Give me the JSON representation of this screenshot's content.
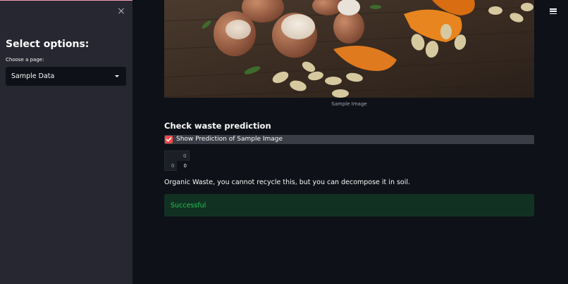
{
  "sidebar": {
    "close_icon": "×",
    "heading": "Select options:",
    "page_label": "Choose a page:",
    "page_select_value": "Sample Data"
  },
  "main": {
    "image_caption": "Sample Image",
    "section_title": "Check waste prediction",
    "checkbox_label": "Show Prediction of Sample Image",
    "checkbox_checked": true,
    "dataframe": {
      "column_header": "0",
      "row_index": "0",
      "cell_value": "0"
    },
    "prediction_text": "Organic Waste, you cannot recycle this, but you can decompose it in soil.",
    "success_message": "Successful"
  },
  "colors": {
    "sidebar_bg": "#262730",
    "main_bg": "#0e1117",
    "checkbox_accent": "#ff4b4b",
    "success_bg": "#113222",
    "success_text": "#21c354"
  }
}
